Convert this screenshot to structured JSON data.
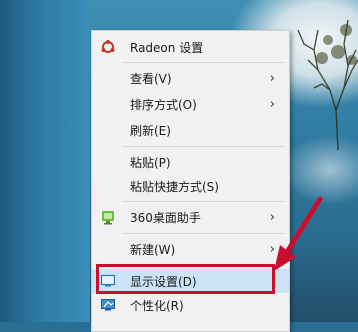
{
  "menu": {
    "items": [
      {
        "label": "Radeon 设置",
        "has_submenu": false,
        "icon": "radeon-icon"
      },
      {
        "label": "查看(V)",
        "has_submenu": true
      },
      {
        "label": "排序方式(O)",
        "has_submenu": true
      },
      {
        "label": "刷新(E)",
        "has_submenu": false
      },
      {
        "label": "粘贴(P)",
        "has_submenu": false
      },
      {
        "label": "粘贴快捷方式(S)",
        "has_submenu": false
      },
      {
        "label": "360桌面助手",
        "has_submenu": true,
        "icon": "360-desktop-icon"
      },
      {
        "label": "新建(W)",
        "has_submenu": true
      },
      {
        "label": "显示设置(D)",
        "has_submenu": false,
        "icon": "display-icon",
        "highlighted": true
      },
      {
        "label": "个性化(R)",
        "has_submenu": false,
        "icon": "personalize-icon"
      }
    ],
    "submenu_glyph": "›"
  },
  "colors": {
    "annotation_red": "#c8102e",
    "highlight": "#cbe3f7"
  }
}
